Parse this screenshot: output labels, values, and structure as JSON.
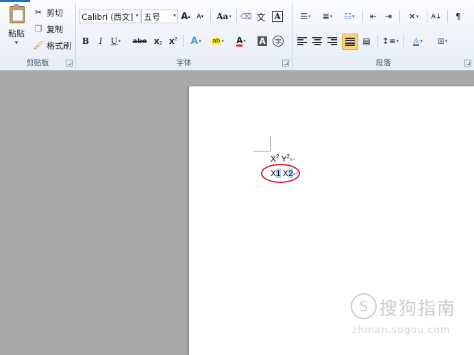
{
  "clipboard": {
    "paste_label": "粘贴",
    "cut_label": "剪切",
    "copy_label": "复制",
    "format_painter_label": "格式刷",
    "group_label": "剪贴板"
  },
  "font": {
    "font_name": "Calibri (西文]",
    "font_size": "五号",
    "grow_label": "A",
    "shrink_label": "A",
    "change_case_label": "Aa",
    "bold_label": "B",
    "italic_label": "I",
    "underline_label": "U",
    "strike_label": "abe",
    "subscript_label": "x",
    "superscript_label": "x",
    "font_color_label": "A",
    "char_shading_label": "A",
    "enclose_label": "字",
    "char_border_label": "A",
    "group_label": "字体"
  },
  "paragraph": {
    "group_label": "段落",
    "sort_label": "A↓"
  },
  "document": {
    "line1_x": "X",
    "line1_x_sup": "2",
    "line1_y": "Y",
    "line1_y_sup": "2",
    "line2_a": "X1",
    "line2_b": "X2",
    "pilcrow": "↵"
  },
  "watermark": {
    "brand": "搜狗指南",
    "url": "zhinan.sogou.com"
  },
  "colors": {
    "accent_selection": "#f9d27a",
    "annotation_ellipse": "#d4202b",
    "text_selection": "#b6d0f2"
  }
}
